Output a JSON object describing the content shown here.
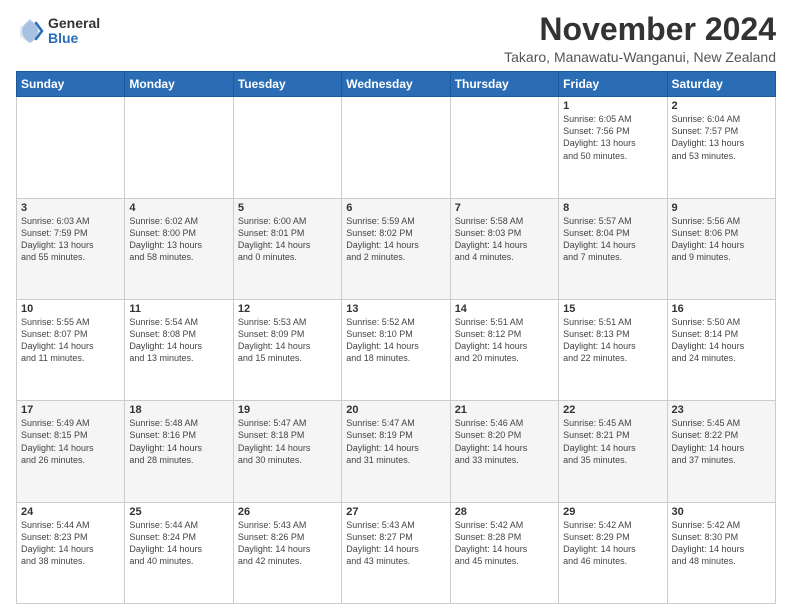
{
  "logo": {
    "general": "General",
    "blue": "Blue"
  },
  "title": "November 2024",
  "subtitle": "Takaro, Manawatu-Wanganui, New Zealand",
  "weekdays": [
    "Sunday",
    "Monday",
    "Tuesday",
    "Wednesday",
    "Thursday",
    "Friday",
    "Saturday"
  ],
  "weeks": [
    [
      {
        "day": "",
        "info": ""
      },
      {
        "day": "",
        "info": ""
      },
      {
        "day": "",
        "info": ""
      },
      {
        "day": "",
        "info": ""
      },
      {
        "day": "",
        "info": ""
      },
      {
        "day": "1",
        "info": "Sunrise: 6:05 AM\nSunset: 7:56 PM\nDaylight: 13 hours\nand 50 minutes."
      },
      {
        "day": "2",
        "info": "Sunrise: 6:04 AM\nSunset: 7:57 PM\nDaylight: 13 hours\nand 53 minutes."
      }
    ],
    [
      {
        "day": "3",
        "info": "Sunrise: 6:03 AM\nSunset: 7:59 PM\nDaylight: 13 hours\nand 55 minutes."
      },
      {
        "day": "4",
        "info": "Sunrise: 6:02 AM\nSunset: 8:00 PM\nDaylight: 13 hours\nand 58 minutes."
      },
      {
        "day": "5",
        "info": "Sunrise: 6:00 AM\nSunset: 8:01 PM\nDaylight: 14 hours\nand 0 minutes."
      },
      {
        "day": "6",
        "info": "Sunrise: 5:59 AM\nSunset: 8:02 PM\nDaylight: 14 hours\nand 2 minutes."
      },
      {
        "day": "7",
        "info": "Sunrise: 5:58 AM\nSunset: 8:03 PM\nDaylight: 14 hours\nand 4 minutes."
      },
      {
        "day": "8",
        "info": "Sunrise: 5:57 AM\nSunset: 8:04 PM\nDaylight: 14 hours\nand 7 minutes."
      },
      {
        "day": "9",
        "info": "Sunrise: 5:56 AM\nSunset: 8:06 PM\nDaylight: 14 hours\nand 9 minutes."
      }
    ],
    [
      {
        "day": "10",
        "info": "Sunrise: 5:55 AM\nSunset: 8:07 PM\nDaylight: 14 hours\nand 11 minutes."
      },
      {
        "day": "11",
        "info": "Sunrise: 5:54 AM\nSunset: 8:08 PM\nDaylight: 14 hours\nand 13 minutes."
      },
      {
        "day": "12",
        "info": "Sunrise: 5:53 AM\nSunset: 8:09 PM\nDaylight: 14 hours\nand 15 minutes."
      },
      {
        "day": "13",
        "info": "Sunrise: 5:52 AM\nSunset: 8:10 PM\nDaylight: 14 hours\nand 18 minutes."
      },
      {
        "day": "14",
        "info": "Sunrise: 5:51 AM\nSunset: 8:12 PM\nDaylight: 14 hours\nand 20 minutes."
      },
      {
        "day": "15",
        "info": "Sunrise: 5:51 AM\nSunset: 8:13 PM\nDaylight: 14 hours\nand 22 minutes."
      },
      {
        "day": "16",
        "info": "Sunrise: 5:50 AM\nSunset: 8:14 PM\nDaylight: 14 hours\nand 24 minutes."
      }
    ],
    [
      {
        "day": "17",
        "info": "Sunrise: 5:49 AM\nSunset: 8:15 PM\nDaylight: 14 hours\nand 26 minutes."
      },
      {
        "day": "18",
        "info": "Sunrise: 5:48 AM\nSunset: 8:16 PM\nDaylight: 14 hours\nand 28 minutes."
      },
      {
        "day": "19",
        "info": "Sunrise: 5:47 AM\nSunset: 8:18 PM\nDaylight: 14 hours\nand 30 minutes."
      },
      {
        "day": "20",
        "info": "Sunrise: 5:47 AM\nSunset: 8:19 PM\nDaylight: 14 hours\nand 31 minutes."
      },
      {
        "day": "21",
        "info": "Sunrise: 5:46 AM\nSunset: 8:20 PM\nDaylight: 14 hours\nand 33 minutes."
      },
      {
        "day": "22",
        "info": "Sunrise: 5:45 AM\nSunset: 8:21 PM\nDaylight: 14 hours\nand 35 minutes."
      },
      {
        "day": "23",
        "info": "Sunrise: 5:45 AM\nSunset: 8:22 PM\nDaylight: 14 hours\nand 37 minutes."
      }
    ],
    [
      {
        "day": "24",
        "info": "Sunrise: 5:44 AM\nSunset: 8:23 PM\nDaylight: 14 hours\nand 38 minutes."
      },
      {
        "day": "25",
        "info": "Sunrise: 5:44 AM\nSunset: 8:24 PM\nDaylight: 14 hours\nand 40 minutes."
      },
      {
        "day": "26",
        "info": "Sunrise: 5:43 AM\nSunset: 8:26 PM\nDaylight: 14 hours\nand 42 minutes."
      },
      {
        "day": "27",
        "info": "Sunrise: 5:43 AM\nSunset: 8:27 PM\nDaylight: 14 hours\nand 43 minutes."
      },
      {
        "day": "28",
        "info": "Sunrise: 5:42 AM\nSunset: 8:28 PM\nDaylight: 14 hours\nand 45 minutes."
      },
      {
        "day": "29",
        "info": "Sunrise: 5:42 AM\nSunset: 8:29 PM\nDaylight: 14 hours\nand 46 minutes."
      },
      {
        "day": "30",
        "info": "Sunrise: 5:42 AM\nSunset: 8:30 PM\nDaylight: 14 hours\nand 48 minutes."
      }
    ]
  ]
}
